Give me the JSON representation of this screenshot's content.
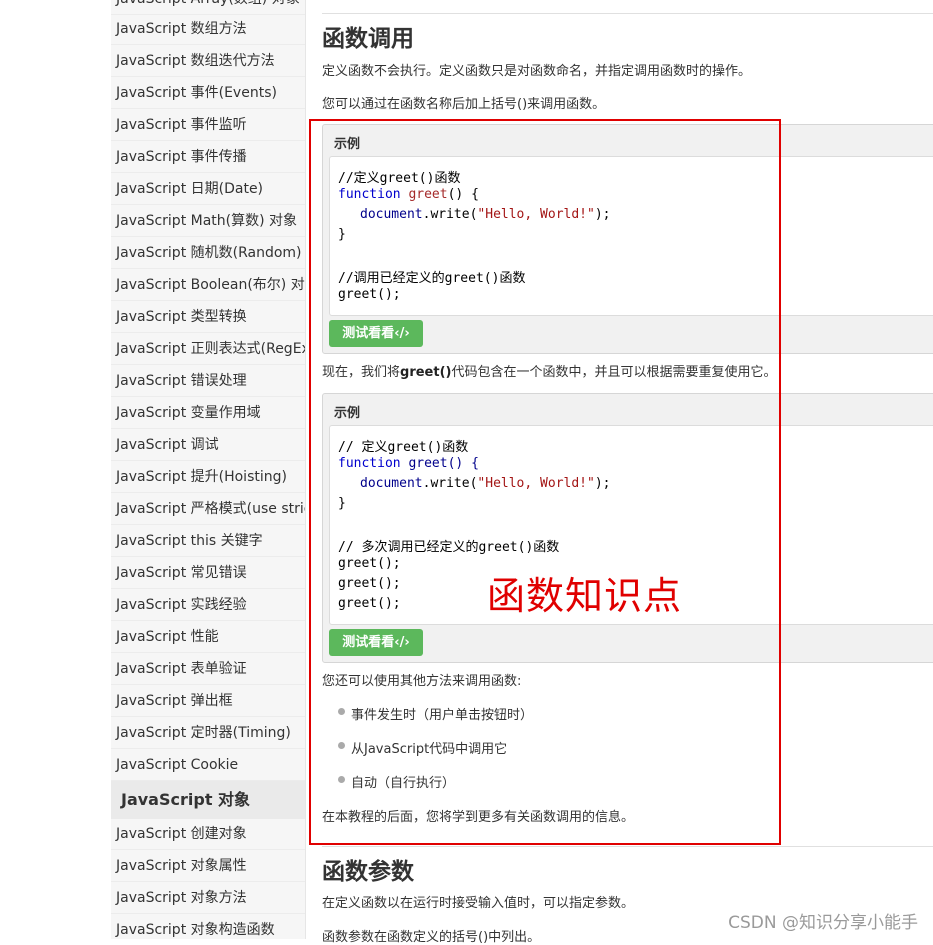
{
  "sidebar": {
    "top_partial": "JavaScript Array(数组) 对象",
    "items": [
      "JavaScript 数组方法",
      "JavaScript 数组迭代方法",
      "JavaScript 事件(Events)",
      "JavaScript 事件监听",
      "JavaScript 事件传播",
      "JavaScript 日期(Date)",
      "JavaScript Math(算数) 对象",
      "JavaScript 随机数(Random)",
      "JavaScript Boolean(布尔) 对象",
      "JavaScript 类型转换",
      "JavaScript 正则表达式(RegExp)",
      "JavaScript 错误处理",
      "JavaScript 变量作用域",
      "JavaScript 调试",
      "JavaScript 提升(Hoisting)",
      "JavaScript 严格模式(use strict)",
      "JavaScript this 关键字",
      "JavaScript 常见错误",
      "JavaScript 实践经验",
      "JavaScript 性能",
      "JavaScript 表单验证",
      "JavaScript 弹出框",
      "JavaScript 定时器(Timing)",
      "JavaScript Cookie"
    ],
    "section_heading": "JavaScript 对象",
    "items2": [
      "JavaScript 创建对象",
      "JavaScript 对象属性",
      "JavaScript 对象方法",
      "JavaScript 对象构造函数"
    ]
  },
  "main": {
    "section1_title": "函数调用",
    "para1": "定义函数不会执行。定义函数只是对函数命名，并指定调用函数时的操作。",
    "para2": "您可以通过在函数名称后加上括号()来调用函数。",
    "example_label": "示例",
    "example1": {
      "comment1": "//定义greet()函数",
      "kw": "function",
      "fn": "greet",
      "sig_rest": "() {",
      "body_obj": "document",
      "body_method": ".write(",
      "body_str": "\"Hello, World!\"",
      "body_end": ");",
      "close": "}",
      "comment2": "//调用已经定义的greet()函数",
      "call": "greet();"
    },
    "try_button": "测试看看‹/›",
    "para3_pre": "现在，我们将",
    "para3_bold": "greet()",
    "para3_post": "代码包含在一个函数中，并且可以根据需要重复使用它。",
    "example2": {
      "comment1": "// 定义greet()函数",
      "kw": "function",
      "fn_sig": "greet() {",
      "body_obj": "document",
      "body_method": ".write(",
      "body_str": "\"Hello, World!\"",
      "body_end": ");",
      "close": "}",
      "comment2": "// 多次调用已经定义的greet()函数",
      "call1": "greet();",
      "call2": "greet();",
      "call3": "greet();"
    },
    "para4": "您还可以使用其他方法来调用函数:",
    "bullets": [
      "事件发生时（用户单击按钮时）",
      "从JavaScript代码中调用它",
      "自动（自行执行）"
    ],
    "para5": "在本教程的后面，您将学到更多有关函数调用的信息。",
    "section2_title": "函数参数",
    "para6": "在定义函数以在运行时接受输入值时，可以指定参数。",
    "para7": "函数参数在函数定义的括号()中列出。"
  },
  "annotation": {
    "label": "函数知识点",
    "color": "#e00000"
  },
  "watermark": "CSDN @知识分享小能手",
  "colors": {
    "button_green": "#5cb85c",
    "comment_green": "#008000",
    "keyword_blue": "#0000cd"
  }
}
